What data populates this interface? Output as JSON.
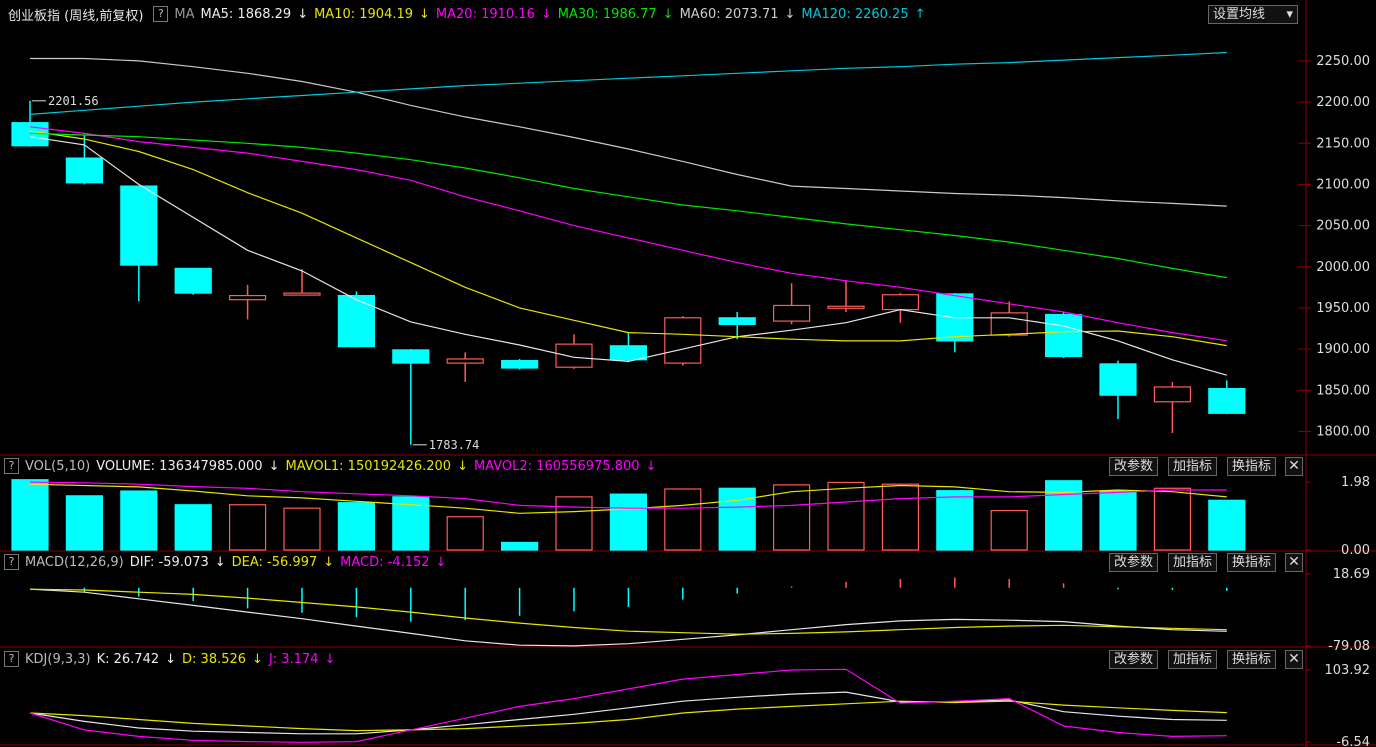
{
  "colors": {
    "up": "#ff5a5a",
    "down": "#00ffff",
    "ma5": "#e6e6e6",
    "ma10": "#e6e600",
    "ma20": "#ff00ff",
    "ma30": "#00e600",
    "ma60": "#c8c8c8",
    "ma120": "#00c8dc",
    "axis": "#8c0000",
    "grid": "#6e0000"
  },
  "header": {
    "title": "创业板指 (周线,前复权)",
    "help": "?",
    "ma_label": "MA",
    "ma5": "MA5: 1868.29",
    "ma5_arrow": "↓",
    "ma10": "MA10: 1904.19",
    "ma10_arrow": "↓",
    "ma20": "MA20: 1910.16",
    "ma20_arrow": "↓",
    "ma30": "MA30: 1986.77",
    "ma30_arrow": "↓",
    "ma60": "MA60: 2073.71",
    "ma60_arrow": "↓",
    "ma120": "MA120: 2260.25",
    "ma120_arrow": "↑",
    "settings_button": "设置均线",
    "settings_caret": "▾"
  },
  "vol_header": {
    "help": "?",
    "name": "VOL(5,10)",
    "volume": "VOLUME: 136347985.000",
    "volume_arrow": "↓",
    "mavol1": "MAVOL1: 150192426.200",
    "mavol1_arrow": "↓",
    "mavol2": "MAVOL2: 160556975.800",
    "mavol2_arrow": "↓"
  },
  "macd_header": {
    "help": "?",
    "name": "MACD(12,26,9)",
    "dif": "DIF: -59.073",
    "dif_arrow": "↓",
    "dea": "DEA: -56.997",
    "dea_arrow": "↓",
    "macd": "MACD: -4.152",
    "macd_arrow": "↓"
  },
  "kdj_header": {
    "help": "?",
    "name": "KDJ(9,3,3)",
    "k": "K: 26.742",
    "k_arrow": "↓",
    "d": "D: 38.526",
    "d_arrow": "↓",
    "j": "J: 3.174",
    "j_arrow": "↓"
  },
  "buttons": {
    "params": "改参数",
    "add": "加指标",
    "switch": "换指标",
    "close": "✕"
  },
  "chart_data": [
    {
      "type": "candlestick",
      "title": "创业板指 (周线,前复权)",
      "ylim": [
        1775,
        2290
      ],
      "yticks": [
        "2250.00",
        "2200.00",
        "2150.00",
        "2100.00",
        "2050.00",
        "2000.00",
        "1950.00",
        "1900.00",
        "1850.00",
        "1800.00"
      ],
      "ytick_values": [
        2250,
        2200,
        2150,
        2100,
        2050,
        2000,
        1950,
        1900,
        1850,
        1800
      ],
      "annotations": [
        {
          "text": "2201.56",
          "value": 2201.56,
          "index": 0
        },
        {
          "text": "1783.74",
          "value": 1783.74,
          "index": 7
        }
      ],
      "candles": [
        {
          "o": 2175,
          "c": 2147,
          "h": 2201.56,
          "l": 2146
        },
        {
          "o": 2132,
          "c": 2102,
          "h": 2160,
          "l": 2100
        },
        {
          "o": 2098,
          "c": 2002,
          "h": 2098,
          "l": 1958
        },
        {
          "o": 1998,
          "c": 1968,
          "h": 1998,
          "l": 1966
        },
        {
          "o": 1960,
          "c": 1965,
          "h": 1978,
          "l": 1936
        },
        {
          "o": 1967,
          "c": 1968,
          "h": 1997,
          "l": 1966
        },
        {
          "o": 1965,
          "c": 1903,
          "h": 1970,
          "l": 1902
        },
        {
          "o": 1899,
          "c": 1883,
          "h": 1900,
          "l": 1783.74
        },
        {
          "o": 1883,
          "c": 1888,
          "h": 1896,
          "l": 1860
        },
        {
          "o": 1886,
          "c": 1877,
          "h": 1888,
          "l": 1875
        },
        {
          "o": 1878,
          "c": 1906,
          "h": 1918,
          "l": 1876
        },
        {
          "o": 1904,
          "c": 1887,
          "h": 1920,
          "l": 1884
        },
        {
          "o": 1883,
          "c": 1938,
          "h": 1940,
          "l": 1880
        },
        {
          "o": 1938,
          "c": 1930,
          "h": 1945,
          "l": 1912
        },
        {
          "o": 1934,
          "c": 1953,
          "h": 1980,
          "l": 1930
        },
        {
          "o": 1950,
          "c": 1952,
          "h": 1984,
          "l": 1945
        },
        {
          "o": 1948,
          "c": 1966,
          "h": 1968,
          "l": 1932
        },
        {
          "o": 1967,
          "c": 1910,
          "h": 1968,
          "l": 1896
        },
        {
          "o": 1917,
          "c": 1944,
          "h": 1958,
          "l": 1915
        },
        {
          "o": 1942,
          "c": 1891,
          "h": 1945,
          "l": 1889
        },
        {
          "o": 1882,
          "c": 1844,
          "h": 1886,
          "l": 1815
        },
        {
          "o": 1836,
          "c": 1854,
          "h": 1860,
          "l": 1798
        },
        {
          "o": 1852,
          "c": 1822,
          "h": 1862,
          "l": 1821
        }
      ],
      "series": [
        {
          "name": "MA5",
          "color": "ma5",
          "values": [
            2158,
            2148,
            2100,
            2060,
            2020,
            1995,
            1960,
            1933,
            1918,
            1905,
            1890,
            1885,
            1900,
            1915,
            1923,
            1932,
            1948,
            1938,
            1938,
            1928,
            1910,
            1887,
            1868.29
          ]
        },
        {
          "name": "MA10",
          "color": "ma10",
          "values": [
            2165,
            2155,
            2140,
            2118,
            2090,
            2065,
            2035,
            2005,
            1975,
            1950,
            1935,
            1920,
            1918,
            1915,
            1912,
            1910,
            1910,
            1915,
            1918,
            1921,
            1922,
            1915,
            1904.19
          ]
        },
        {
          "name": "MA20",
          "color": "ma20",
          "values": [
            2170,
            2162,
            2152,
            2145,
            2138,
            2128,
            2118,
            2105,
            2085,
            2068,
            2050,
            2035,
            2020,
            2005,
            1992,
            1983,
            1975,
            1965,
            1955,
            1945,
            1932,
            1920,
            1910.16
          ]
        },
        {
          "name": "MA30",
          "color": "ma30",
          "values": [
            2162,
            2160,
            2158,
            2154,
            2150,
            2145,
            2138,
            2130,
            2120,
            2108,
            2095,
            2085,
            2075,
            2068,
            2060,
            2052,
            2045,
            2038,
            2030,
            2020,
            2010,
            1998,
            1986.77
          ]
        },
        {
          "name": "MA60",
          "color": "ma60",
          "values": [
            2253,
            2253,
            2250,
            2243,
            2235,
            2225,
            2212,
            2196,
            2182,
            2170,
            2157,
            2143,
            2128,
            2112,
            2098,
            2095,
            2092,
            2089,
            2087,
            2084,
            2080,
            2077,
            2073.71
          ]
        },
        {
          "name": "MA120",
          "color": "ma120",
          "values": [
            2185,
            2190,
            2195,
            2200,
            2204,
            2208,
            2212,
            2216,
            2220,
            2223,
            2226,
            2229,
            2232,
            2235,
            2238,
            2241,
            2243,
            2246,
            2248,
            2251,
            2254,
            2257,
            2260.25
          ]
        }
      ]
    },
    {
      "type": "bar",
      "title": "VOL(5,10)",
      "ylim": [
        0,
        2.1
      ],
      "yticks": [
        "1.98",
        "0.00"
      ],
      "ytick_values": [
        1.98,
        0
      ],
      "values": [
        2.05,
        1.58,
        1.72,
        1.32,
        1.32,
        1.22,
        1.38,
        1.55,
        0.97,
        0.22,
        1.55,
        1.63,
        1.78,
        1.8,
        1.9,
        1.97,
        1.92,
        1.73,
        1.15,
        2.02,
        1.72,
        1.8,
        1.45
      ],
      "series": [
        {
          "name": "MAVOL1",
          "color": "ma10",
          "values": [
            1.92,
            1.88,
            1.84,
            1.72,
            1.58,
            1.52,
            1.42,
            1.32,
            1.22,
            1.07,
            1.12,
            1.2,
            1.3,
            1.45,
            1.7,
            1.8,
            1.88,
            1.84,
            1.7,
            1.68,
            1.75,
            1.7,
            1.55
          ]
        },
        {
          "name": "MAVOL2",
          "color": "ma20",
          "values": [
            1.98,
            1.96,
            1.92,
            1.85,
            1.8,
            1.7,
            1.64,
            1.58,
            1.5,
            1.3,
            1.25,
            1.22,
            1.22,
            1.25,
            1.3,
            1.4,
            1.5,
            1.55,
            1.55,
            1.62,
            1.68,
            1.75,
            1.75
          ]
        }
      ]
    },
    {
      "type": "bar",
      "title": "MACD(12,26,9)",
      "ylim": [
        -79.08,
        18.69
      ],
      "yticks": [
        "18.69",
        "-79.08"
      ],
      "ytick_values": [
        18.69,
        -79.08
      ],
      "values": [
        0,
        -6,
        -12,
        -18,
        -28,
        -34,
        -40,
        -46,
        -44,
        -38,
        -32,
        -26,
        -16,
        -8,
        2,
        8,
        12,
        14,
        12,
        6,
        -2,
        -3,
        -4.152
      ],
      "series": [
        {
          "name": "DIF",
          "color": "ma5",
          "values": [
            -2,
            -6,
            -15,
            -24,
            -33,
            -42,
            -52,
            -62,
            -72,
            -78,
            -79,
            -76,
            -70,
            -64,
            -57,
            -50,
            -45,
            -43,
            -44,
            -46,
            -52,
            -57,
            -59.073
          ]
        },
        {
          "name": "DEA",
          "color": "ma10",
          "values": [
            -2,
            -3,
            -6,
            -9,
            -14,
            -20,
            -26,
            -33,
            -41,
            -48,
            -54,
            -59,
            -61,
            -63,
            -62,
            -60,
            -57,
            -54,
            -52,
            -51,
            -53,
            -55,
            -56.997
          ]
        }
      ]
    },
    {
      "type": "line",
      "title": "KDJ(9,3,3)",
      "ylim": [
        -6.54,
        103.92
      ],
      "yticks": [
        "103.92",
        "-6.54"
      ],
      "ytick_values": [
        103.92,
        -6.54
      ],
      "series": [
        {
          "name": "K",
          "color": "ma5",
          "values": [
            38,
            25,
            15,
            10,
            8,
            6,
            6,
            12,
            20,
            28,
            36,
            46,
            56,
            62,
            67,
            70,
            55,
            55,
            58,
            40,
            33,
            28,
            26.742
          ]
        },
        {
          "name": "D",
          "color": "ma10",
          "values": [
            38,
            34,
            28,
            22,
            18,
            14,
            11,
            12,
            14,
            18,
            22,
            28,
            38,
            44,
            48,
            52,
            56,
            54,
            56,
            50,
            46,
            42,
            38.526
          ]
        },
        {
          "name": "J",
          "color": "ma20",
          "values": [
            38,
            12,
            2,
            -4,
            -6,
            -7,
            -6,
            12,
            30,
            48,
            60,
            75,
            90,
            97,
            103.92,
            105,
            53,
            56,
            60,
            18,
            8,
            2,
            3.174
          ]
        }
      ]
    }
  ]
}
